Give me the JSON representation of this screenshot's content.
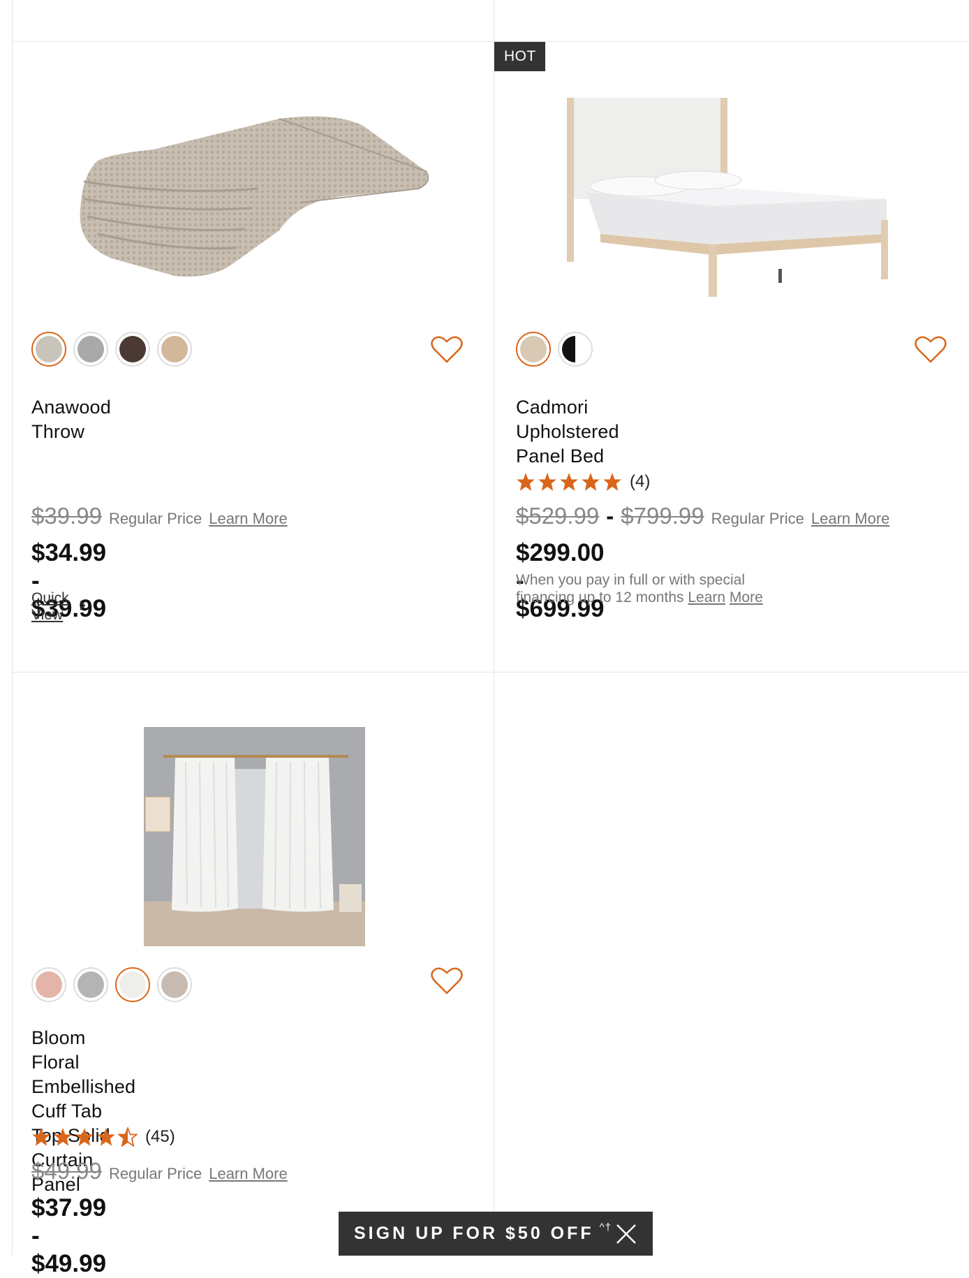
{
  "products": [
    {
      "badge": "",
      "title_lines": [
        "Anawood Throw"
      ],
      "swatch_colors": [
        "#c9c4b9",
        "#a9a9a9",
        "#4a3a33",
        "#d2b79a"
      ],
      "selected_swatch": 0,
      "rating": null,
      "rating_count": "",
      "regular_price_parts": [
        "$39.99"
      ],
      "regular_label": "Regular Price",
      "learn_more": "Learn More",
      "sale_price": "$34.99 - $39.99",
      "quick_view": "Quick View",
      "note": ""
    },
    {
      "badge": "HOT BUY",
      "title_lines": [
        "Cadmori Upholstered Panel Bed"
      ],
      "swatch_colors": [
        "#d9c9b4",
        "split"
      ],
      "selected_swatch": 0,
      "rating": 5,
      "rating_count": "(4)",
      "regular_price_parts": [
        "$529.99",
        "$799.99"
      ],
      "regular_label": "Regular Price",
      "learn_more": "Learn More",
      "sale_price": "$299.00 - $699.99",
      "quick_view": "",
      "note": "When you pay in full or with special financing up to 12 months",
      "note_link_1": "Learn",
      "note_link_2": "More"
    },
    {
      "badge": "",
      "title_lines": [
        "Bloom Floral Embellished Cuff Tab Top Solid",
        "Curtain Panel"
      ],
      "swatch_colors": [
        "#e4b4a8",
        "#b4b4b4",
        "#eeeeea",
        "#c7bab1"
      ],
      "selected_swatch": 2,
      "rating": 4.5,
      "rating_count": "(45)",
      "regular_price_parts": [
        "$49.99"
      ],
      "regular_label": "Regular Price",
      "learn_more": "Learn More",
      "sale_price": "$37.99 - $49.99",
      "quick_view": "",
      "note": ""
    }
  ],
  "signup": {
    "label": "SIGN UP FOR $50 OFF",
    "superscript": "^†"
  },
  "colors": {
    "accent": "#d9661a",
    "badge_bg": "#333333"
  }
}
